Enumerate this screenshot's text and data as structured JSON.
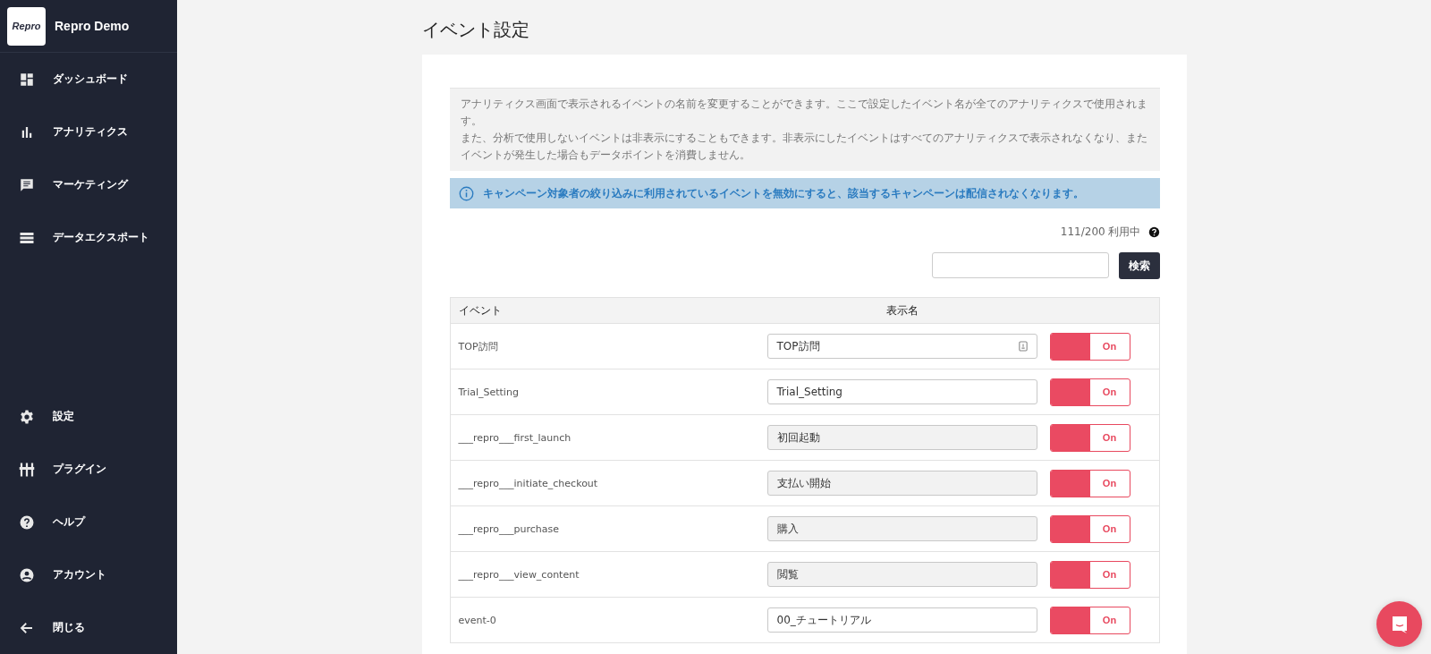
{
  "brand": {
    "logo": "Repro",
    "name": "Repro Demo"
  },
  "nav_top": [
    {
      "label": "ダッシュボード"
    },
    {
      "label": "アナリティクス"
    },
    {
      "label": "マーケティング"
    },
    {
      "label": "データエクスポート"
    }
  ],
  "nav_bottom": [
    {
      "label": "設定"
    },
    {
      "label": "プラグイン"
    },
    {
      "label": "ヘルプ"
    },
    {
      "label": "アカウント"
    },
    {
      "label": "閉じる"
    }
  ],
  "page_title": "イベント設定",
  "description": [
    "アナリティクス画面で表示されるイベントの名前を変更することができます。ここで設定したイベント名が全てのアナリティクスで使用されます。",
    "また、分析で使用しないイベントは非表示にすることもできます。非表示にしたイベントはすべてのアナリティクスで表示されなくなり、またイベントが発生した場合もデータポイントを消費しません。"
  ],
  "info_notice": "キャンペーン対象者の絞り込みに利用されているイベントを無効にすると、該当するキャンペーンは配信されなくなります。",
  "usage": "111/200 利用中",
  "search": {
    "button": "検索"
  },
  "table": {
    "columns": [
      "イベント",
      "表示名"
    ],
    "rows": [
      {
        "event": "TOP訪問",
        "display_name": "TOP訪問",
        "disabled": false,
        "field_icon": true,
        "toggle": "On",
        "on": true
      },
      {
        "event": "Trial_Setting",
        "display_name": "Trial_Setting",
        "disabled": false,
        "field_icon": false,
        "toggle": "On",
        "on": true
      },
      {
        "event": "___repro___first_launch",
        "display_name": "初回起動",
        "disabled": true,
        "field_icon": false,
        "toggle": "On",
        "on": true
      },
      {
        "event": "___repro___initiate_checkout",
        "display_name": "支払い開始",
        "disabled": true,
        "field_icon": false,
        "toggle": "On",
        "on": true
      },
      {
        "event": "___repro___purchase",
        "display_name": "購入",
        "disabled": true,
        "field_icon": false,
        "toggle": "On",
        "on": true
      },
      {
        "event": "___repro___view_content",
        "display_name": "閲覧",
        "disabled": true,
        "field_icon": false,
        "toggle": "On",
        "on": true
      },
      {
        "event": "event-0",
        "display_name": "00_チュートリアル",
        "disabled": false,
        "field_icon": false,
        "toggle": "On",
        "on": true
      }
    ]
  }
}
